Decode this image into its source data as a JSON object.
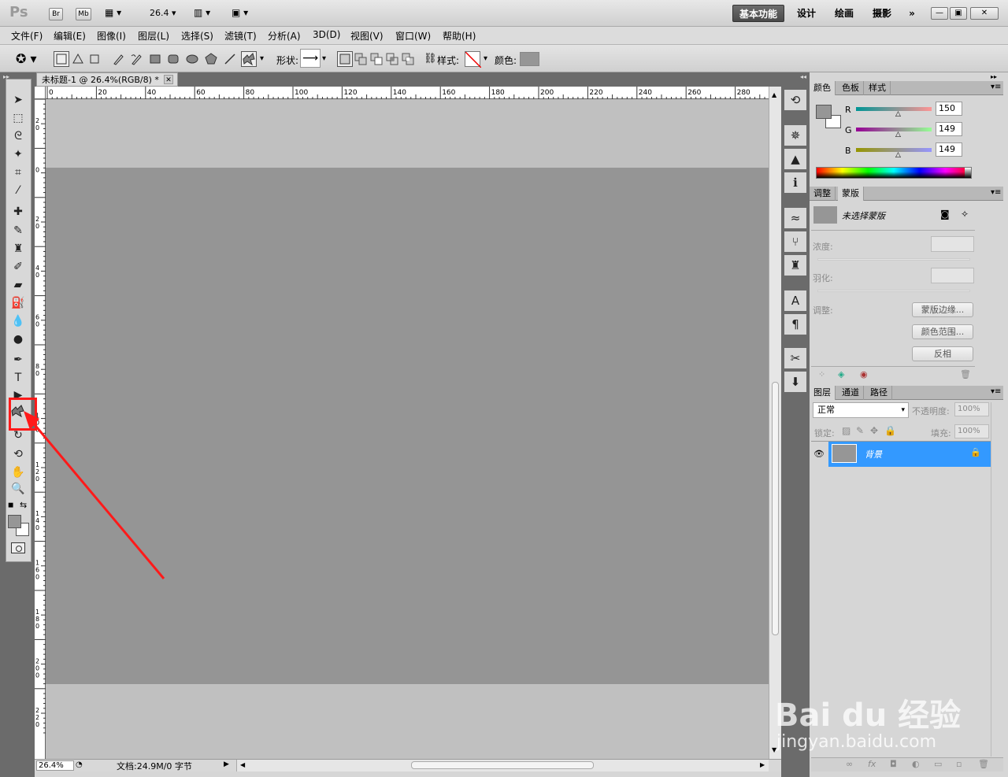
{
  "app": {
    "logo": "Ps",
    "br": "Br",
    "mb": "Mb",
    "zoom": "26.4"
  },
  "workspaces": [
    "基本功能",
    "设计",
    "绘画",
    "摄影",
    "»"
  ],
  "window_buttons": [
    "—",
    "▣",
    "✕"
  ],
  "menu": [
    "文件(F)",
    "编辑(E)",
    "图像(I)",
    "图层(L)",
    "选择(S)",
    "滤镜(T)",
    "分析(A)",
    "3D(D)",
    "视图(V)",
    "窗口(W)",
    "帮助(H)"
  ],
  "options": {
    "shape_label": "形状:",
    "style_label": "样式:",
    "color_label": "颜色:",
    "swatch_color": "#969696"
  },
  "document": {
    "tab_title": "未标题-1 @ 26.4%(RGB/8) *",
    "close": "✕"
  },
  "ruler_top": [
    "0",
    "20",
    "40",
    "60",
    "80",
    "100",
    "120",
    "140",
    "160",
    "180",
    "200",
    "220",
    "240",
    "260",
    "280"
  ],
  "ruler_left": [
    "20",
    "0",
    "20",
    "40",
    "60",
    "80",
    "100",
    "120",
    "140",
    "160",
    "180",
    "200",
    "220"
  ],
  "status": {
    "zoom": "26.4%",
    "doc": "文档:24.9M/0 字节"
  },
  "color_panel": {
    "tabs": [
      "颜色",
      "色板",
      "样式"
    ],
    "r_label": "R",
    "g_label": "G",
    "b_label": "B",
    "r_value": "150",
    "g_value": "149",
    "b_value": "149"
  },
  "masks_panel": {
    "tabs": [
      "调整",
      "蒙版"
    ],
    "title": "未选择蒙版",
    "density_label": "浓度:",
    "feather_label": "羽化:",
    "adjust_label": "调整:",
    "btn_mask_edge": "蒙版边缘...",
    "btn_color_range": "颜色范围...",
    "btn_invert": "反相"
  },
  "layers_panel": {
    "tabs": [
      "图层",
      "通道",
      "路径"
    ],
    "blend_mode": "正常",
    "opacity_label": "不透明度:",
    "opacity_value": "100%",
    "lock_label": "锁定:",
    "fill_label": "填充:",
    "fill_value": "100%",
    "layer_name": "背景",
    "footer_icons": [
      "∞",
      "fx",
      "◘",
      "◐",
      "▭",
      "▫",
      "🗑"
    ]
  },
  "watermark": {
    "brand": "Bai du 经验",
    "url": "jingyan.baidu.com"
  },
  "annotation_color": "#ff1a1a"
}
